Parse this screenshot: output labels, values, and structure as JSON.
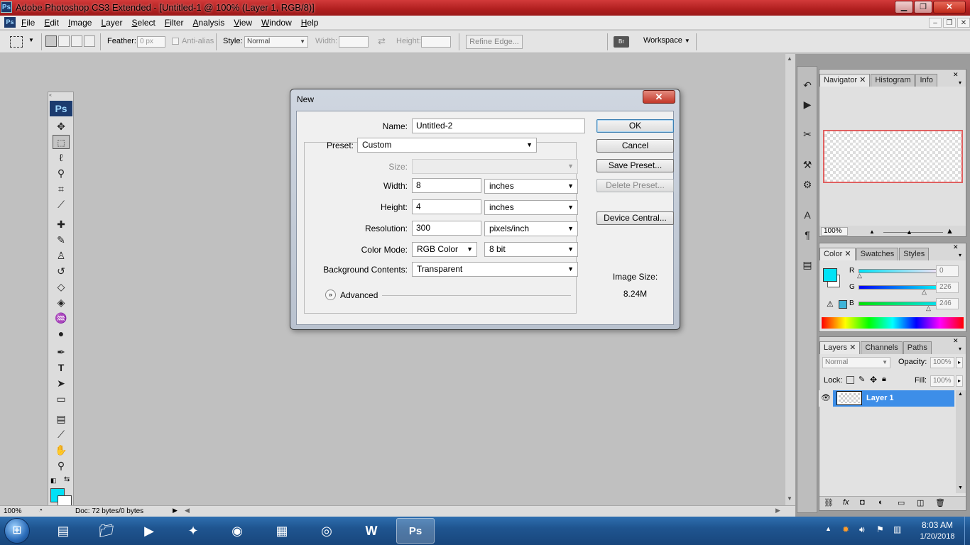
{
  "window": {
    "title": "Adobe Photoshop CS3 Extended - [Untitled-1 @ 100% (Layer 1, RGB/8)]",
    "app_icon": "Ps",
    "minimize": "▁",
    "maximize": "❐",
    "close": "✕"
  },
  "menu": {
    "items": [
      "File",
      "Edit",
      "Image",
      "Layer",
      "Select",
      "Filter",
      "Analysis",
      "View",
      "Window",
      "Help"
    ],
    "doc_min": "–",
    "doc_restore": "❐",
    "doc_close": "✕"
  },
  "options_bar": {
    "feather_label": "Feather:",
    "feather_value": "0 px",
    "antialias_label": "Anti-alias",
    "style_label": "Style:",
    "style_value": "Normal",
    "width_label": "Width:",
    "height_label": "Height:",
    "refine_edge": "Refine Edge...",
    "workspace": "Workspace"
  },
  "toolbox": {
    "badge": "Ps",
    "fg_color": "#00e1f6",
    "bg_color": "#ffffff"
  },
  "status_bar": {
    "zoom": "100%",
    "doc_info": "Doc: 72 bytes/0 bytes"
  },
  "dialog": {
    "title": "New",
    "close": "✕",
    "name_label": "Name:",
    "name_value": "Untitled-2",
    "preset_label": "Preset:",
    "preset_value": "Custom",
    "size_label": "Size:",
    "width_label": "Width:",
    "width_value": "8",
    "width_unit": "inches",
    "height_label": "Height:",
    "height_value": "4",
    "height_unit": "inches",
    "resolution_label": "Resolution:",
    "resolution_value": "300",
    "resolution_unit": "pixels/inch",
    "color_mode_label": "Color Mode:",
    "color_mode_value": "RGB Color",
    "bit_depth_value": "8 bit",
    "bg_contents_label": "Background Contents:",
    "bg_contents_value": "Transparent",
    "advanced_label": "Advanced",
    "ok": "OK",
    "cancel": "Cancel",
    "save_preset": "Save Preset...",
    "delete_preset": "Delete Preset...",
    "device_central": "Device Central...",
    "image_size_label": "Image Size:",
    "image_size_value": "8.24M"
  },
  "navigator_panel": {
    "tabs": [
      "Navigator",
      "Histogram",
      "Info"
    ],
    "zoom": "100%"
  },
  "color_panel": {
    "tabs": [
      "Color",
      "Swatches",
      "Styles"
    ],
    "r_label": "R",
    "r_value": "0",
    "g_label": "G",
    "g_value": "226",
    "b_label": "B",
    "b_value": "246",
    "fg_color": "#00e2f6"
  },
  "layers_panel": {
    "tabs": [
      "Layers",
      "Channels",
      "Paths"
    ],
    "blend_mode": "Normal",
    "opacity_label": "Opacity:",
    "opacity_value": "100%",
    "lock_label": "Lock:",
    "fill_label": "Fill:",
    "fill_value": "100%",
    "layer_name": "Layer 1",
    "selected_color": "#3d8ee8"
  },
  "taskbar": {
    "time": "8:03 AM",
    "date": "1/20/2018"
  }
}
